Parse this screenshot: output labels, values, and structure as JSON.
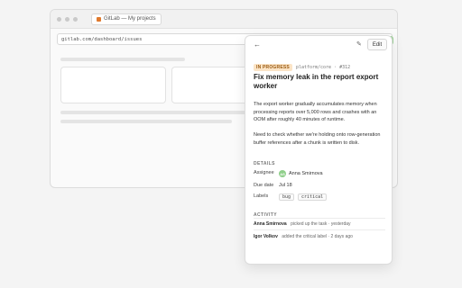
{
  "browser": {
    "tab_title": "GitLab — My projects",
    "url": "gitlab.com/dashboard/issues"
  },
  "drawer": {
    "edit_label": "Edit",
    "back_icon": "←",
    "edit_icon": "✎"
  },
  "issue": {
    "status": "IN PROGRESS",
    "meta": "platform/core · #312",
    "title": "Fix memory leak in the report export worker",
    "description_1": "The export worker gradually accumulates memory when processing reports over 5,000 rows and crashes with an OOM after roughly 40 minutes of runtime.",
    "description_2": "Need to check whether we're holding onto row-generation buffer references after a chunk is written to disk."
  },
  "details": {
    "section_title": "DETAILS",
    "assignee_label": "Assignee",
    "assignee_initials": "AS",
    "assignee_name": "Anna Smirnova",
    "due_label": "Due date",
    "due_value": "Jul 18",
    "labels_label": "Labels",
    "labels": [
      "bug",
      "critical"
    ]
  },
  "activity": {
    "section_title": "ACTIVITY",
    "entries": [
      {
        "who": "Anna Smirnova",
        "what": "picked up the task · yesterday"
      },
      {
        "who": "Igor Volkov",
        "what": "added the critical label · 2 days ago"
      }
    ]
  },
  "colors": {
    "status_bg": "#fbe4c6",
    "status_fg": "#9a5b12",
    "avatar": "#8fcf8a"
  }
}
